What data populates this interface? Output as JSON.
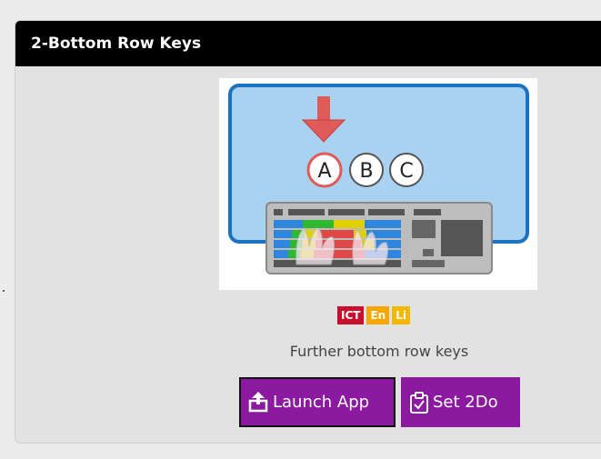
{
  "card": {
    "title": "2-Bottom Row Keys",
    "description": "Further bottom row keys"
  },
  "thumbnail": {
    "letters": [
      "A",
      "B",
      "C"
    ],
    "highlight_letter": "A",
    "icons": [
      "down-arrow-icon",
      "keyboard-icon",
      "hands-icon"
    ]
  },
  "badges": [
    {
      "label": "ICT",
      "color": "#c8102e"
    },
    {
      "label": "En",
      "color": "#f7a800"
    },
    {
      "label": "Li",
      "color": "#f3b800"
    }
  ],
  "buttons": {
    "launch_label": "Launch App",
    "launch_icon": "share-upload-icon",
    "todo_label": "Set 2Do",
    "todo_icon": "clipboard-check-icon"
  },
  "colors": {
    "accent": "#8b1aa0",
    "header_bg": "#000000",
    "thumb_blue": "#a9d1f0",
    "thumb_border": "#1a73c1"
  }
}
